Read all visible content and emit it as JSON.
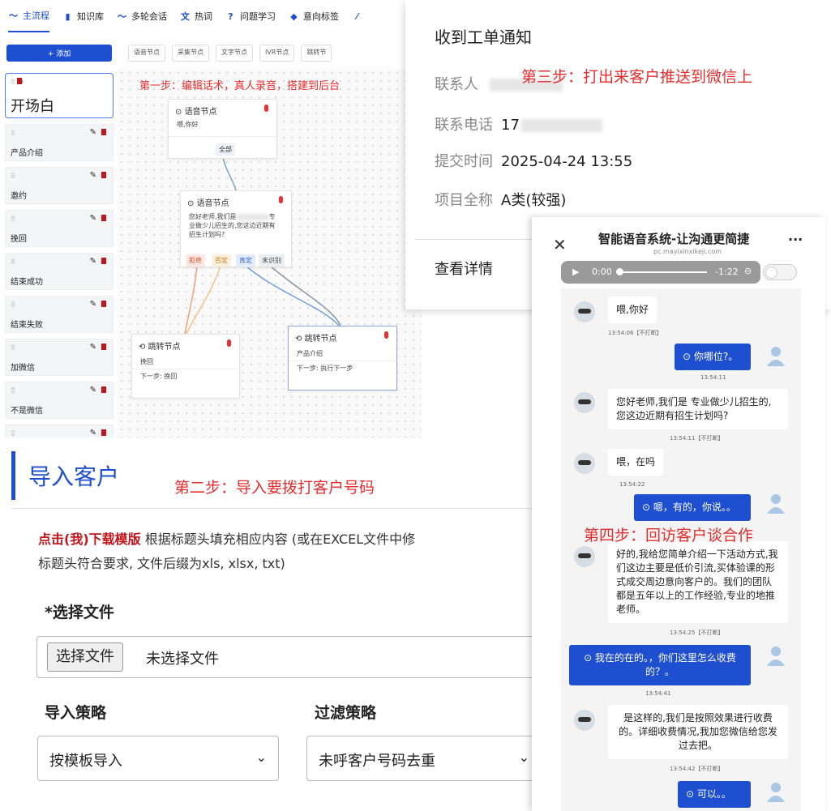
{
  "flow_editor": {
    "tabs": [
      {
        "label": "主流程",
        "icon": "trend-icon"
      },
      {
        "label": "知识库",
        "icon": "book-icon"
      },
      {
        "label": "多轮会话",
        "icon": "trend-icon"
      },
      {
        "label": "热词",
        "icon": "translate-icon"
      },
      {
        "label": "问题学习",
        "icon": "question-icon"
      },
      {
        "label": "意向标签",
        "icon": "tag-icon"
      }
    ],
    "add_button": "+ 添加",
    "node_types": [
      "语音节点",
      "采集节点",
      "文字节点",
      "IVR节点",
      "跳转节"
    ],
    "sidebar_items": [
      "开场白",
      "产品介绍",
      "邀约",
      "挽回",
      "结束成功",
      "结束失败",
      "加微信",
      "不是微信",
      ""
    ],
    "step1": "第一步：编辑话术，真人录音，搭建到后台",
    "node1": {
      "title": "语音节点",
      "text": "喂,你好",
      "branch": "全部"
    },
    "node2": {
      "title": "语音节点",
      "text_line1": "您好老师,我们是",
      "text_line1b": "专",
      "text_line2": "业做少儿招生的,您这边近期有",
      "text_line3": "招生计划吗?",
      "branches": [
        "拒绝",
        "否定",
        "肯定",
        "未识别"
      ]
    },
    "node3": {
      "title": "跳转节点",
      "line1": "挽回",
      "line2": "下一步: 挽回"
    },
    "node4": {
      "title": "跳转节点",
      "line1": "产品介绍",
      "line2": "下一步: 执行下一步"
    }
  },
  "notification": {
    "title": "收到工单通知",
    "step3": "第三步：打出来客户推送到微信上",
    "contact_label": "联系人",
    "phone_label": "联系电话",
    "phone_value": "17",
    "time_label": "提交时间",
    "time_value": "2025-04-24 13:55",
    "project_label": "项目全称",
    "project_value": "A类(较强)",
    "detail": "查看详情"
  },
  "import": {
    "title": "导入客户",
    "step2": "第二步：导入要拨打客户号码",
    "download_link": "点击(我)下载模版",
    "desc_line1": "根据标题头填充相应内容 (或在EXCEL文件中修",
    "desc_line2": "标题头符合要求, 文件后缀为xls, xlsx, txt)",
    "file_label": "*选择文件",
    "file_button": "选择文件",
    "file_status": "未选择文件",
    "strategy_label": "导入策略",
    "filter_label": "过滤策略",
    "strategy_value": "按模板导入",
    "filter_value": "未呼客户号码去重"
  },
  "chat": {
    "title": "智能语音系统-让沟通更简捷",
    "url": "pc.mayixinxikeji.com",
    "audio_start": "0:00",
    "audio_end": "-1:22",
    "step4": "第四步：回访客户谈合作",
    "messages": [
      {
        "side": "bot",
        "text": "喂,你好",
        "time": "13:54:06【不打断】"
      },
      {
        "side": "user",
        "text": "⊙ 你哪位?。",
        "time": "13:54:11"
      },
      {
        "side": "bot",
        "text": "您好老师,我们是          专业做少儿招生的,您这边近期有招生计划吗?",
        "time": "13:54:11【不打断】"
      },
      {
        "side": "bot",
        "text": "喂，在吗",
        "time": "13:54:22"
      },
      {
        "side": "user",
        "text": "⊙ 嗯，有的，你说。。",
        "time": ""
      },
      {
        "side": "bot",
        "text": "好的,我给您简单介绍一下活动方式,我们这边主要是低价引流,买体验课的形式成交周边意向客户的。我们的团队都是五年以上的工作经验,专业的地推老师。",
        "time": "13:54:25【不打断】"
      },
      {
        "side": "user",
        "text": "⊙ 我在的在的。，你们这里怎么收费的？。",
        "time": "13:54:41"
      },
      {
        "side": "bot",
        "text": "是这样的,我们是按照效果进行收费的。详细收费情况,我加您微信给您发过去把。",
        "time": "13:54:42【不打断】"
      },
      {
        "side": "user",
        "text": "⊙ 可以。。",
        "time": ""
      }
    ]
  },
  "colors": {
    "accent": "#1f4fd1",
    "annotation": "#e62e2e",
    "danger": "#c3151b"
  }
}
